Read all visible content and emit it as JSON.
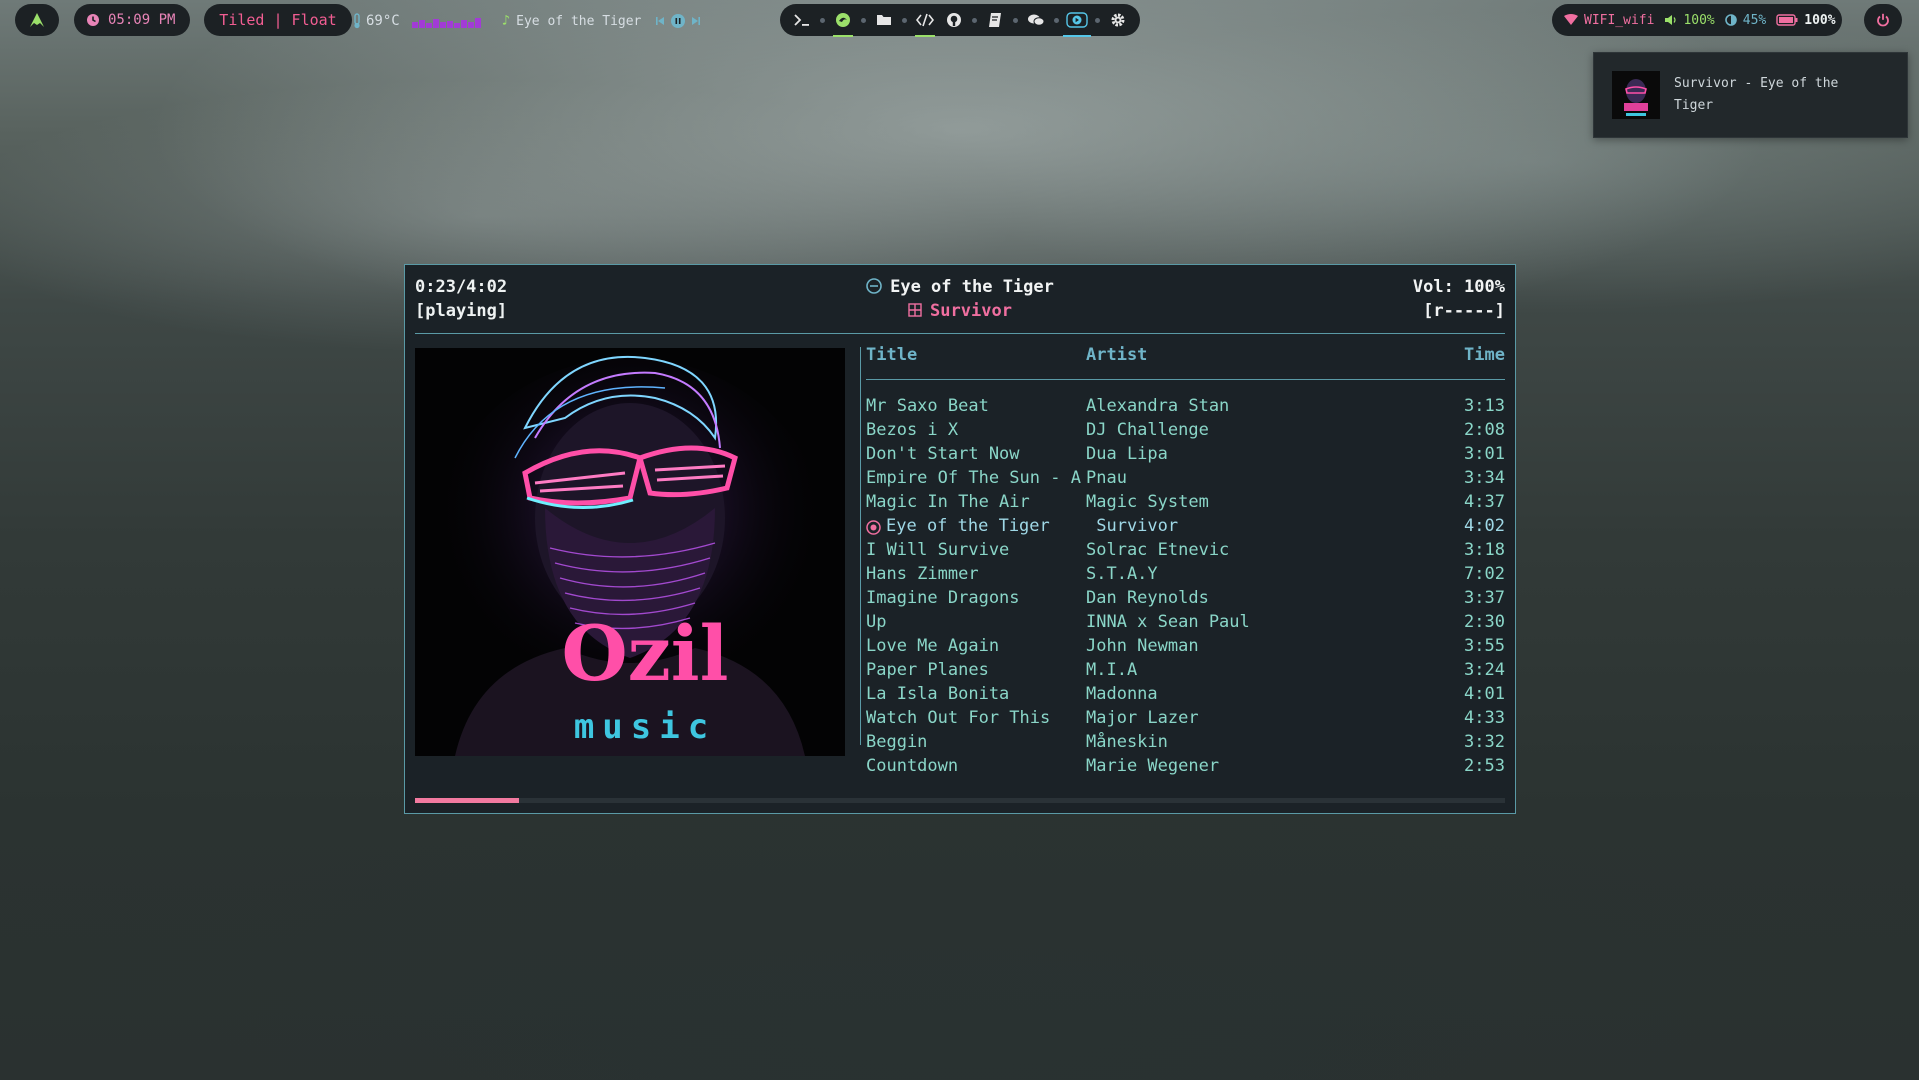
{
  "topbar": {
    "clock": "05:09 PM",
    "layout": "Tiled | Float",
    "temperature": "69°C",
    "media_title": "Eye of the Tiger",
    "status": {
      "wifi": "WIFI_wifi",
      "volume": "100%",
      "brightness": "45%",
      "battery": "100%"
    }
  },
  "notification": {
    "text": "Survivor - Eye of the Tiger"
  },
  "player": {
    "elapsed": "0:23/4:02",
    "state": "[playing]",
    "title": "Eye of the Tiger",
    "artist": "Survivor",
    "volume": "Vol: 100%",
    "flags": "[r-----]",
    "cover_text": {
      "line1": "Ozil",
      "line2": "music"
    },
    "progress": 0.095,
    "columns": {
      "title": "Title",
      "artist": "Artist",
      "time": "Time"
    },
    "tracks": [
      {
        "title": "Mr Saxo Beat",
        "artist": "Alexandra Stan",
        "time": "3:13"
      },
      {
        "title": "Bezos i X",
        "artist": "DJ Challenge",
        "time": "2:08"
      },
      {
        "title": "Don't Start Now",
        "artist": "Dua Lipa",
        "time": "3:01"
      },
      {
        "title": "Empire Of The Sun - A",
        "artist": "Pnau",
        "time": "3:34"
      },
      {
        "title": "Magic In The Air",
        "artist": "Magic System",
        "time": "4:37"
      },
      {
        "title": "Eye of the Tiger",
        "artist": " Survivor",
        "time": "4:02",
        "current": true
      },
      {
        "title": "I Will Survive",
        "artist": "Solrac Etnevic",
        "time": "3:18"
      },
      {
        "title": "Hans Zimmer",
        "artist": "S.T.A.Y",
        "time": "7:02"
      },
      {
        "title": "Imagine Dragons",
        "artist": "Dan Reynolds",
        "time": "3:37"
      },
      {
        "title": "Up",
        "artist": "INNA x Sean Paul",
        "time": "2:30"
      },
      {
        "title": "Love Me Again",
        "artist": "John Newman",
        "time": "3:55"
      },
      {
        "title": "Paper Planes",
        "artist": "M.I.A",
        "time": "3:24"
      },
      {
        "title": "La Isla Bonita",
        "artist": "Madonna",
        "time": "4:01"
      },
      {
        "title": "Watch Out For This",
        "artist": "Major Lazer",
        "time": "4:33"
      },
      {
        "title": "Beggin",
        "artist": "Måneskin",
        "time": "3:32"
      },
      {
        "title": "Countdown",
        "artist": "Marie Wegener",
        "time": "2:53"
      }
    ]
  },
  "colors": {
    "accent_pink": "#f15d92",
    "accent_cyan": "#5a9aa6",
    "list_text": "#8ad6c8",
    "bar_bg": "#1c2124"
  }
}
